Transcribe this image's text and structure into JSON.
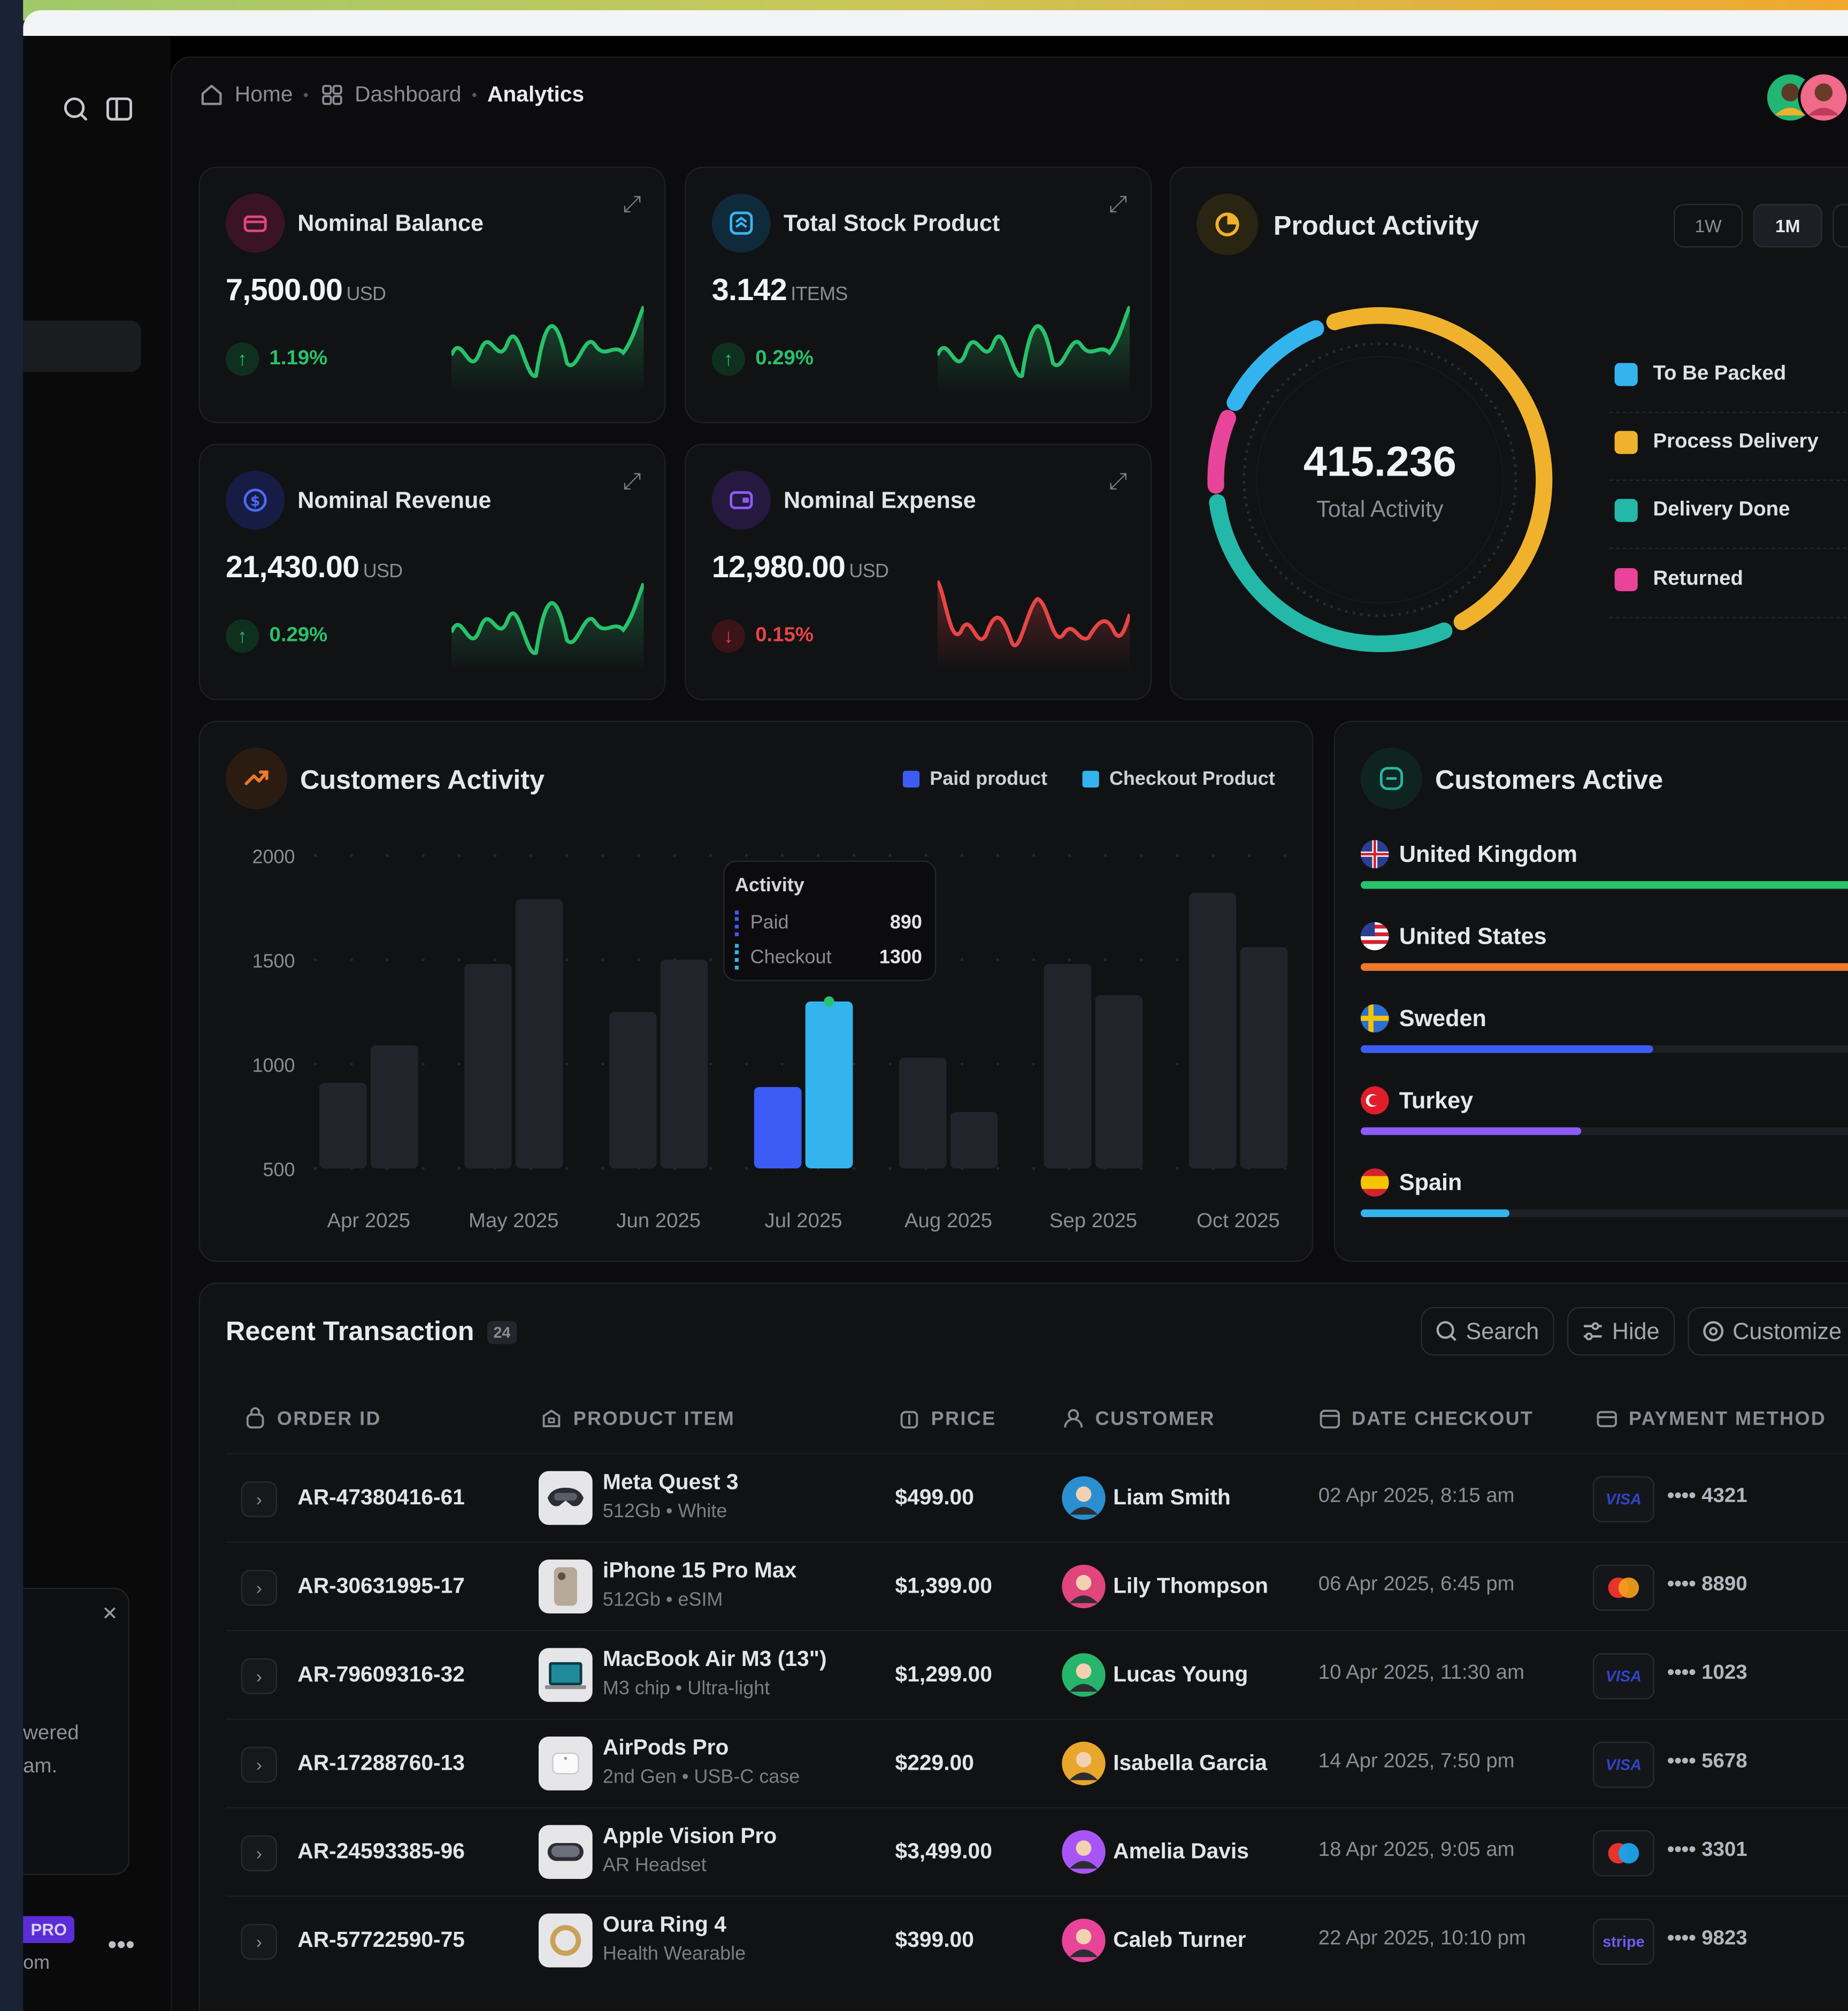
{
  "breadcrumb": {
    "home": "Home",
    "dashboard": "Dashboard",
    "current": "Analytics"
  },
  "kpis": [
    {
      "label": "Nominal Balance",
      "value": "7,500.00",
      "unit": "USD",
      "change": "1.19%",
      "trend": "up",
      "icon": "wallet-icon",
      "color": "#e0457b"
    },
    {
      "label": "Total Stock Product",
      "value": "3.142",
      "unit": "ITEMS",
      "change": "0.29%",
      "trend": "up",
      "icon": "box-icon",
      "color": "#38b6f2"
    },
    {
      "label": "Nominal Revenue",
      "value": "21,430.00",
      "unit": "USD",
      "change": "0.29%",
      "trend": "up",
      "icon": "dollar-icon",
      "color": "#4d6bf5"
    },
    {
      "label": "Nominal Expense",
      "value": "12,980.00",
      "unit": "USD",
      "change": "0.15%",
      "trend": "down",
      "icon": "wallet-icon",
      "color": "#8b5cf6"
    }
  ],
  "product_activity": {
    "title": "Product Activity",
    "periods": [
      "1W",
      "1M"
    ],
    "selected_period": "1M",
    "total": "415.236",
    "total_label": "Total Activity",
    "legend": [
      {
        "label": "To Be Packed",
        "color": "#33b4ee"
      },
      {
        "label": "Process Delivery",
        "color": "#f0b22d"
      },
      {
        "label": "Delivery Done",
        "color": "#24b8a8"
      },
      {
        "label": "Returned",
        "color": "#e8449a"
      }
    ]
  },
  "customers_activity": {
    "title": "Customers Activity",
    "legend": {
      "paid": "Paid product",
      "checkout": "Checkout Product"
    },
    "tooltip": {
      "title": "Activity",
      "paid_label": "Paid",
      "paid_value": "890",
      "checkout_label": "Checkout",
      "checkout_value": "1300"
    },
    "y_ticks": [
      "2000",
      "1500",
      "1000",
      "500"
    ]
  },
  "chart_data": {
    "type": "bar",
    "title": "Customers Activity",
    "categories": [
      "Apr 2025",
      "May 2025",
      "Jun 2025",
      "Jul 2025",
      "Aug 2025",
      "Sep 2025",
      "Oct 2025"
    ],
    "series": [
      {
        "name": "Paid product",
        "values": [
          910,
          1480,
          1250,
          890,
          1030,
          1480,
          1820
        ],
        "color": "#3d5cf5"
      },
      {
        "name": "Checkout Product",
        "values": [
          1090,
          1790,
          1500,
          1300,
          770,
          1330,
          1560
        ],
        "color": "#33b4ee"
      }
    ],
    "highlighted_category": "Jul 2025",
    "ylim": [
      500,
      2000
    ],
    "grid": true,
    "legend_position": "top-right"
  },
  "customers_active": {
    "title": "Customers Active",
    "countries": [
      {
        "name": "United Kingdom",
        "progress": 1.0,
        "color": "#27c26b"
      },
      {
        "name": "United States",
        "progress": 1.0,
        "color": "#f0782d"
      },
      {
        "name": "Sweden",
        "progress": 0.57,
        "color": "#3d5cf5"
      },
      {
        "name": "Turkey",
        "progress": 0.43,
        "color": "#8b5cf6"
      },
      {
        "name": "Spain",
        "progress": 0.29,
        "color": "#33b4ee"
      }
    ]
  },
  "transactions": {
    "title": "Recent Transaction",
    "count": "24",
    "buttons": {
      "search": "Search",
      "hide": "Hide",
      "customize": "Customize"
    },
    "columns": [
      "ORDER ID",
      "PRODUCT ITEM",
      "PRICE",
      "CUSTOMER",
      "DATE CHECKOUT",
      "PAYMENT METHOD"
    ],
    "rows": [
      {
        "order_id": "AR-47380416-61",
        "product": "Meta Quest 3",
        "detail": "512Gb • White",
        "price": "$499.00",
        "customer": "Liam Smith",
        "date": "02 Apr 2025, 8:15 am",
        "method": "visa",
        "method_label": "VISA",
        "card": "•••• 4321",
        "avatar_color": "#2a8fd0"
      },
      {
        "order_id": "AR-30631995-17",
        "product": "iPhone 15 Pro Max",
        "detail": "512Gb • eSIM",
        "price": "$1,399.00",
        "customer": "Lily Thompson",
        "date": "06 Apr 2025, 6:45 pm",
        "method": "mastercard",
        "method_label": "",
        "card": "•••• 8890",
        "avatar_color": "#e0457b"
      },
      {
        "order_id": "AR-79609316-32",
        "product": "MacBook Air M3 (13\")",
        "detail": "M3 chip • Ultra-light",
        "price": "$1,299.00",
        "customer": "Lucas Young",
        "date": "10 Apr 2025, 11:30 am",
        "method": "visa",
        "method_label": "VISA",
        "card": "•••• 1023",
        "avatar_color": "#27b46b"
      },
      {
        "order_id": "AR-17288760-13",
        "product": "AirPods Pro",
        "detail": "2nd Gen • USB-C case",
        "price": "$229.00",
        "customer": "Isabella Garcia",
        "date": "14 Apr 2025, 7:50 pm",
        "method": "visa",
        "method_label": "VISA",
        "card": "•••• 5678",
        "avatar_color": "#e8a62d"
      },
      {
        "order_id": "AR-24593385-96",
        "product": "Apple Vision Pro",
        "detail": "AR Headset",
        "price": "$3,499.00",
        "customer": "Amelia Davis",
        "date": "18 Apr 2025, 9:05 am",
        "method": "maestro",
        "method_label": "",
        "card": "•••• 3301",
        "avatar_color": "#a855f7"
      },
      {
        "order_id": "AR-57722590-75",
        "product": "Oura Ring 4",
        "detail": "Health Wearable",
        "price": "$399.00",
        "customer": "Caleb Turner",
        "date": "22 Apr 2025, 10:10 pm",
        "method": "stripe",
        "method_label": "stripe",
        "card": "•••• 9823",
        "avatar_color": "#e8449a"
      }
    ]
  },
  "sidebar": {
    "promo_text": [
      "wered",
      "am."
    ],
    "badge": "PRO",
    "email_fragment": "om"
  }
}
